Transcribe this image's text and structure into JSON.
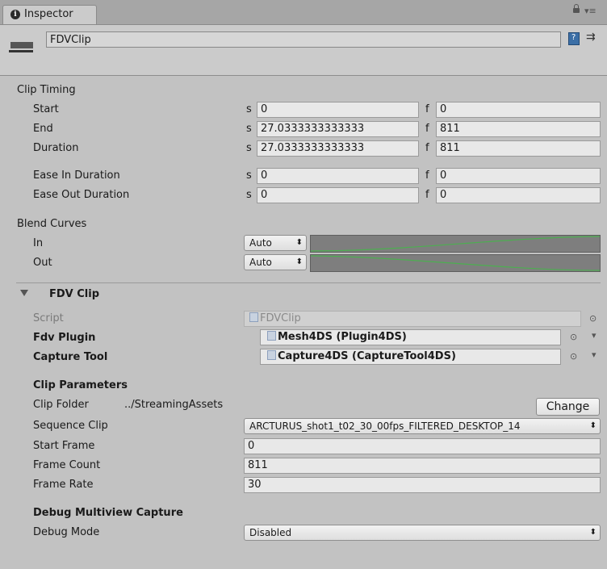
{
  "tab": {
    "title": "Inspector"
  },
  "header": {
    "name": "FDVClip"
  },
  "clip_timing": {
    "label": "Clip Timing",
    "rows": [
      {
        "label": "Start",
        "s_unit": "s",
        "seconds": "0",
        "f_unit": "f",
        "frames": "0"
      },
      {
        "label": "End",
        "s_unit": "s",
        "seconds": "27.0333333333333",
        "f_unit": "f",
        "frames": "811"
      },
      {
        "label": "Duration",
        "s_unit": "s",
        "seconds": "27.0333333333333",
        "f_unit": "f",
        "frames": "811"
      },
      {
        "label": "Ease In Duration",
        "s_unit": "s",
        "seconds": "0",
        "f_unit": "f",
        "frames": "0"
      },
      {
        "label": "Ease Out Duration",
        "s_unit": "s",
        "seconds": "0",
        "f_unit": "f",
        "frames": "0"
      }
    ]
  },
  "blend_curves": {
    "label": "Blend Curves",
    "in": {
      "label": "In",
      "mode": "Auto"
    },
    "out": {
      "label": "Out",
      "mode": "Auto"
    },
    "curve_color": "#4caf50"
  },
  "fdv_clip": {
    "title": "FDV Clip",
    "script": {
      "label": "Script",
      "value": "FDVClip"
    },
    "fdv_plugin": {
      "label": "Fdv Plugin",
      "value": "Mesh4DS (Plugin4DS)"
    },
    "capture_tool": {
      "label": "Capture Tool",
      "value": "Capture4DS (CaptureTool4DS)"
    },
    "clip_parameters": {
      "label": "Clip Parameters",
      "clip_folder": {
        "label": "Clip Folder",
        "value": "../StreamingAssets",
        "button": "Change"
      },
      "sequence_clip": {
        "label": "Sequence Clip",
        "value": "ARCTURUS_shot1_t02_30_00fps_FILTERED_DESKTOP_14"
      },
      "start_frame": {
        "label": "Start Frame",
        "value": "0"
      },
      "frame_count": {
        "label": "Frame Count",
        "value": "811"
      },
      "frame_rate": {
        "label": "Frame Rate",
        "value": "30"
      }
    },
    "debug": {
      "label": "Debug Multiview Capture",
      "mode": {
        "label": "Debug Mode",
        "value": "Disabled"
      }
    }
  }
}
